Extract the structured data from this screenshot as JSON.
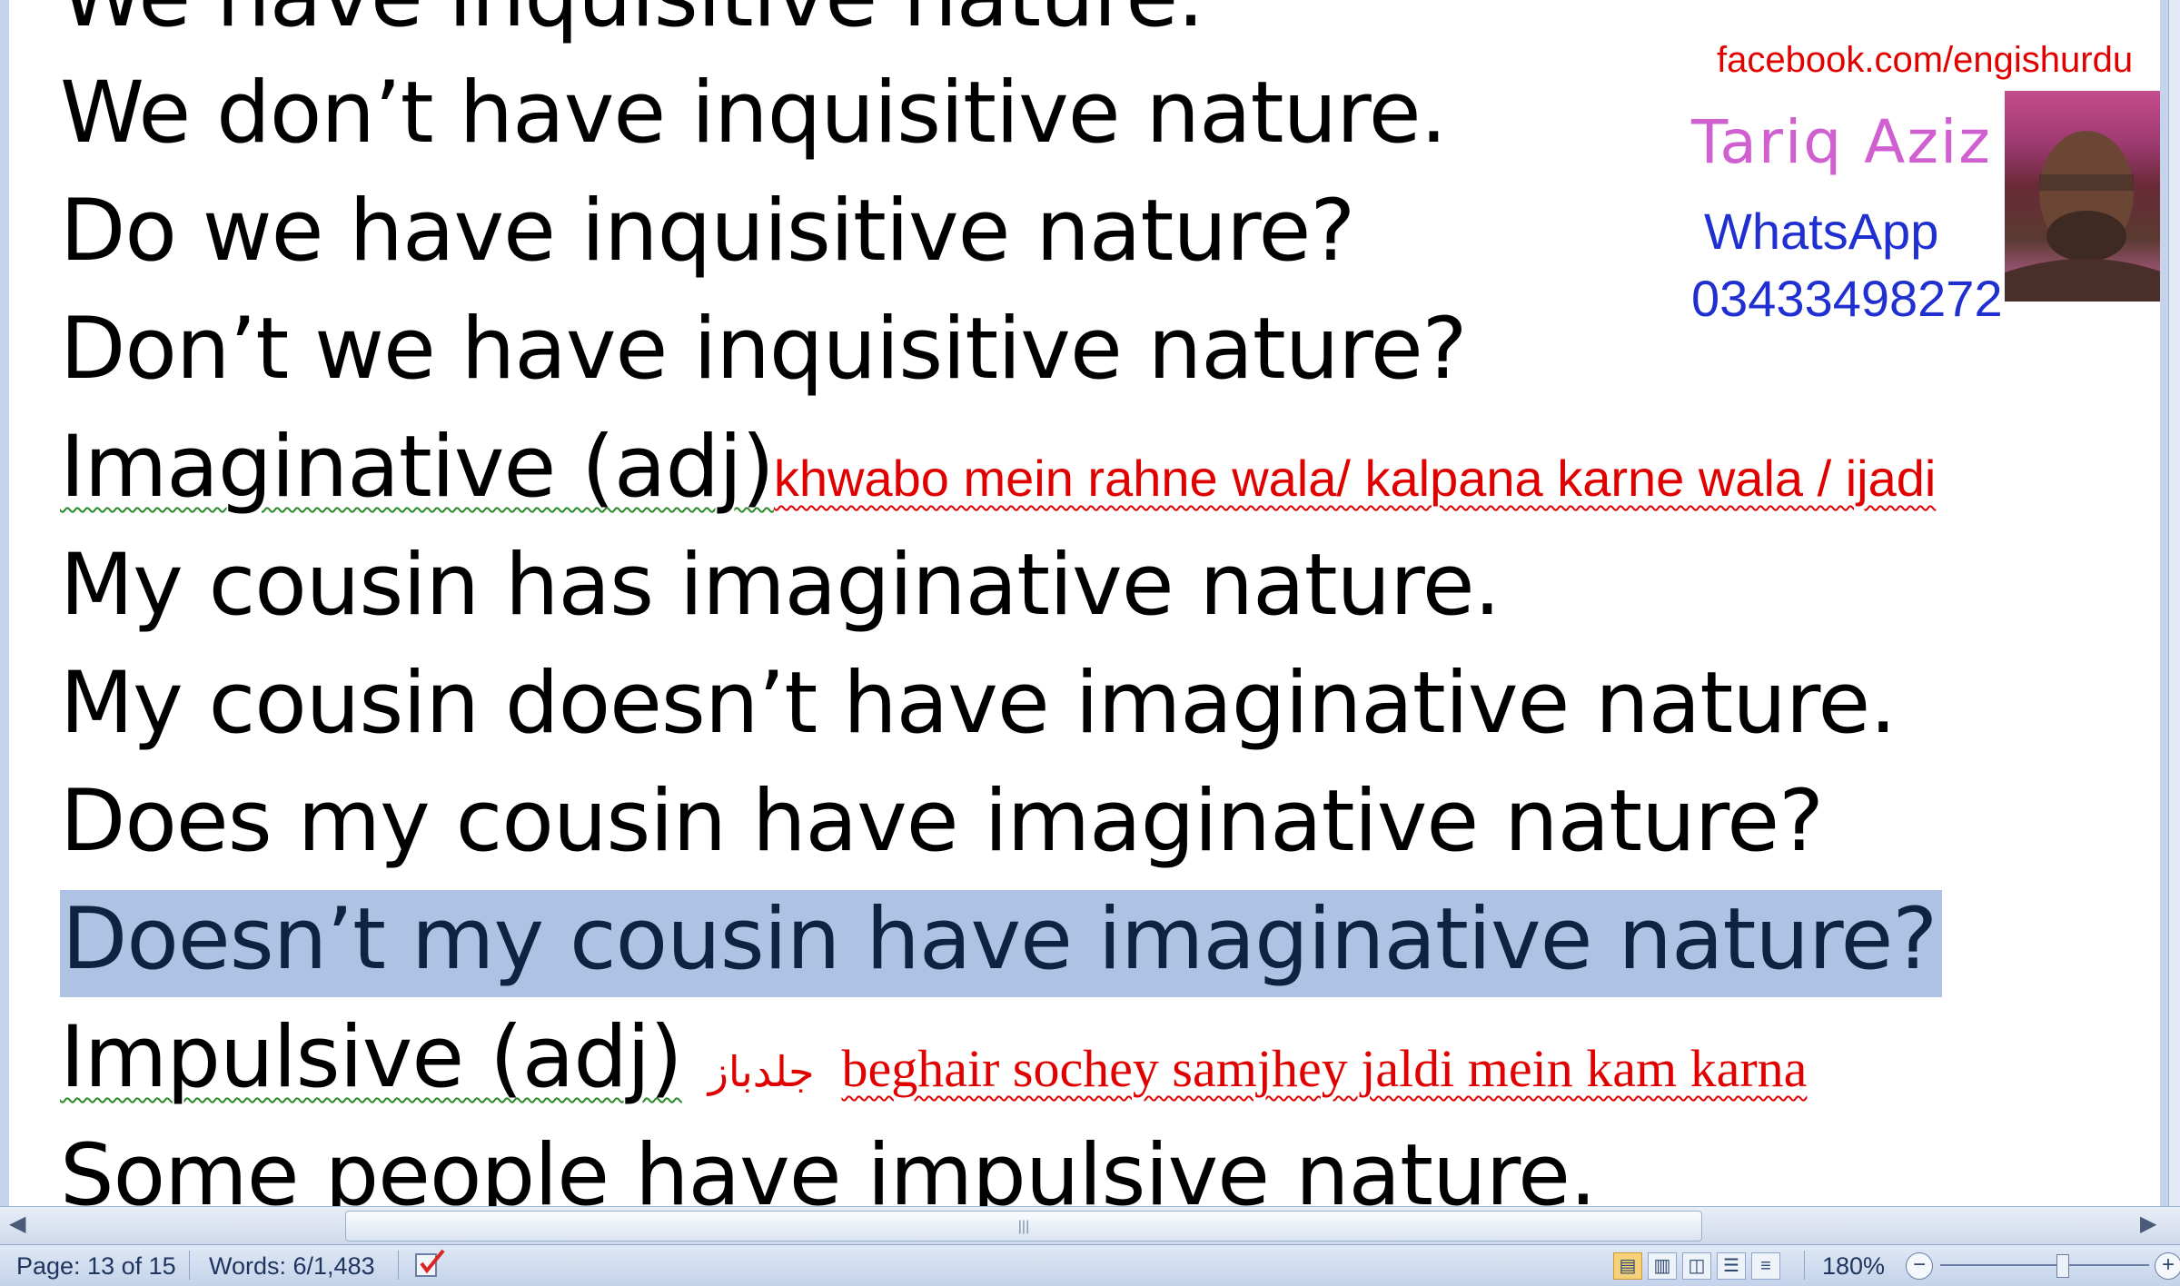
{
  "document": {
    "lines": [
      "We have inquisitive nature.",
      "We don’t have inquisitive nature.",
      "Do we have inquisitive nature?",
      "Don’t we have inquisitive nature?",
      "Imaginative (adj)",
      "My cousin has imaginative nature.",
      "My cousin doesn’t have imaginative nature.",
      "Does my cousin have imaginative nature?",
      "Doesn’t my cousin have imaginative nature?",
      "Impulsive (adj)",
      "Some people have impulsive nature."
    ],
    "imaginative_meaning": "khwabo mein rahne wala/ kalpana karne wala / ijadi",
    "impulsive_urdu": "جلدباز",
    "impulsive_meaning": "beghair sochey samjhey jaldi mein kam karna"
  },
  "contact": {
    "facebook": "facebook.com/engishurdu",
    "name": "Tariq Aziz",
    "whatsapp_label": "WhatsApp",
    "phone": "03433498272"
  },
  "status_bar": {
    "page": "Page: 13 of 15",
    "words": "Words: 6/1,483",
    "zoom": "180%",
    "proofing_icon": "proofing-check-icon"
  },
  "colors": {
    "selection": "#aec3e4",
    "annotation_red": "#e00000",
    "name_pink": "#d060d0",
    "whatsapp_blue": "#2030d0"
  }
}
